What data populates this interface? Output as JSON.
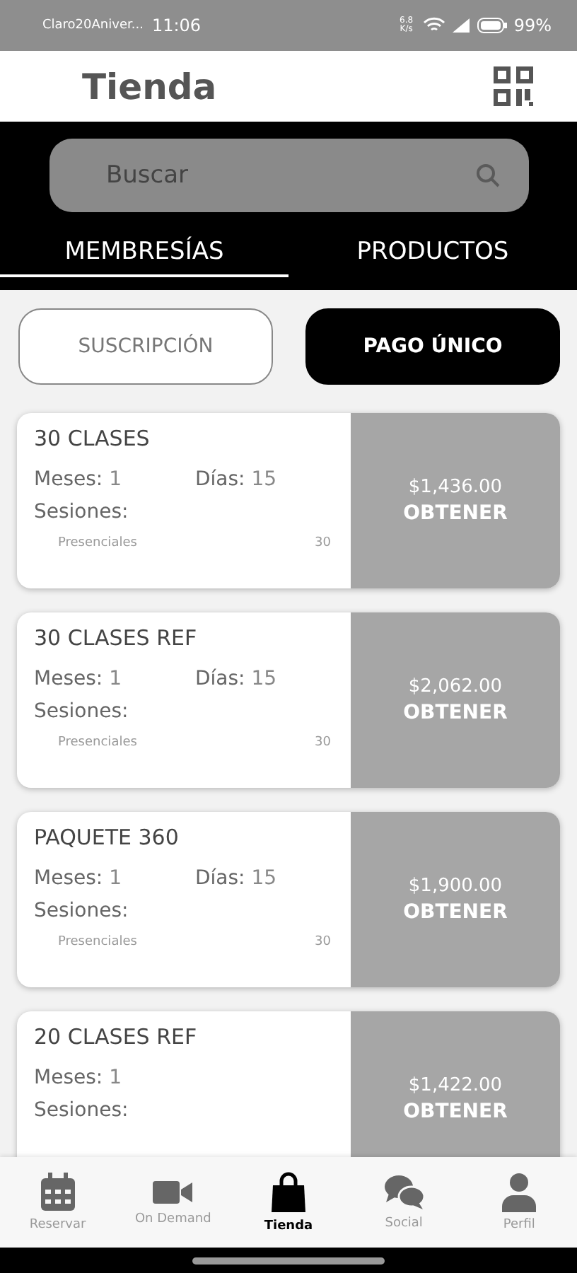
{
  "status_bar": {
    "carrier": "Claro20Aniver...",
    "time": "11:06",
    "speed": "6.8 K/s",
    "battery": "99%"
  },
  "header": {
    "title": "Tienda"
  },
  "search": {
    "placeholder": "Buscar"
  },
  "tabs": [
    {
      "label": "MEMBRESÍAS",
      "selected": true
    },
    {
      "label": "PRODUCTOS",
      "selected": false
    }
  ],
  "toggle": [
    {
      "label": "SUSCRIPCIÓN",
      "selected": false
    },
    {
      "label": "PAGO ÚNICO",
      "selected": true
    }
  ],
  "cards": [
    {
      "title": "30 CLASES",
      "months_label": "Meses:",
      "months": "1",
      "days_label": "Días:",
      "days": "15",
      "sessions_label": "Sesiones:",
      "sessions": [
        {
          "name": "Presenciales",
          "count": "30"
        }
      ],
      "price": "$1,436.00",
      "action": "OBTENER"
    },
    {
      "title": "30 CLASES REF",
      "months_label": "Meses:",
      "months": "1",
      "days_label": "Días:",
      "days": "15",
      "sessions_label": "Sesiones:",
      "sessions": [
        {
          "name": "Presenciales",
          "count": "30"
        }
      ],
      "price": "$2,062.00",
      "action": "OBTENER"
    },
    {
      "title": "PAQUETE 360",
      "months_label": "Meses:",
      "months": "1",
      "days_label": "Días:",
      "days": "15",
      "sessions_label": "Sesiones:",
      "sessions": [
        {
          "name": "Presenciales",
          "count": "30"
        }
      ],
      "price": "$1,900.00",
      "action": "OBTENER"
    },
    {
      "title": "20 CLASES REF",
      "months_label": "Meses:",
      "months": "1",
      "sessions_label": "Sesiones:",
      "price": "$1,422.00",
      "action": "OBTENER"
    }
  ],
  "nav": [
    {
      "label": "Reservar",
      "kind": "calendar",
      "selected": false
    },
    {
      "label": "On Demand",
      "kind": "video",
      "selected": false
    },
    {
      "label": "Tienda",
      "kind": "bag",
      "selected": true
    },
    {
      "label": "Social",
      "kind": "chat",
      "selected": false
    },
    {
      "label": "Perfil",
      "kind": "person",
      "selected": false
    }
  ]
}
